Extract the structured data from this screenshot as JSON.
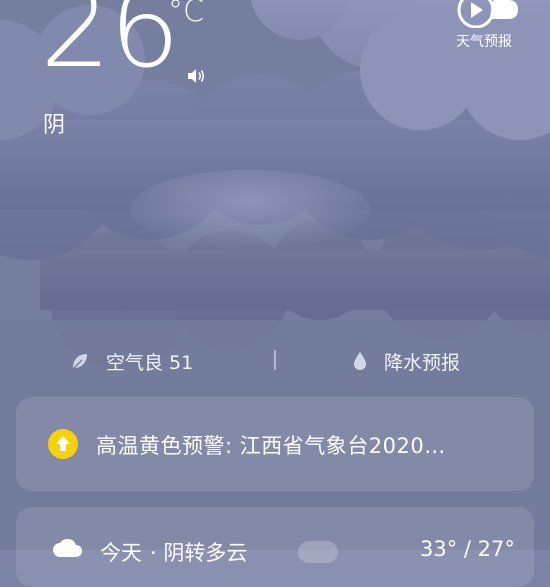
{
  "current": {
    "temperature": "26",
    "unit": "°C",
    "condition": "阴"
  },
  "forecast_button": {
    "label": "天气预报"
  },
  "info_row": {
    "aqi": "空气良 51",
    "precip": "降水预报"
  },
  "alert": {
    "text": "高温黄色预警: 江西省气象台2020…",
    "color": "#f5d20c"
  },
  "daily": {
    "label": "今天",
    "description": "· 阴转多云",
    "badge": "",
    "temp": "33° / 27°"
  },
  "colors": {
    "background": "#767ea0",
    "cloud_light": "#8e95b8",
    "cloud_dark": "#6a7196",
    "card": "rgba(255,255,255,0.11)"
  }
}
